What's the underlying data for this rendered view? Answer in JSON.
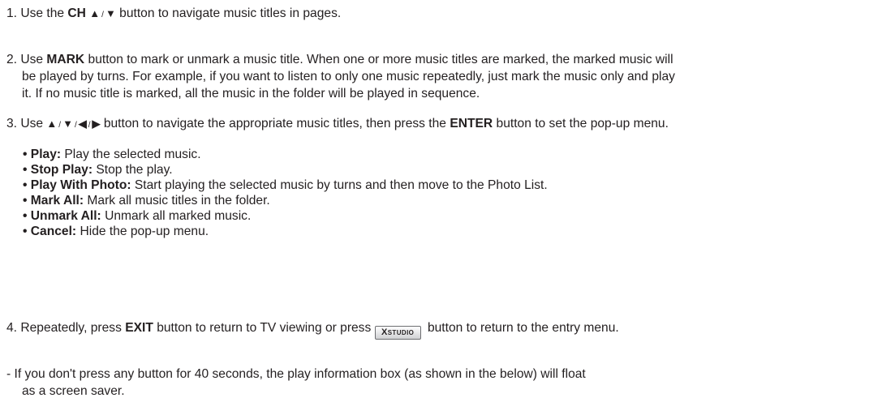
{
  "step1": {
    "prefix": "1. Use the ",
    "key": "CH ",
    "up": "▲",
    "sep": "/",
    "down": "▼",
    "suffix": " button to navigate music titles in pages."
  },
  "step2": {
    "prefix": "2. Use ",
    "key": "MARK",
    "line1_suffix": " button to mark or unmark a music title. When one or more music titles are marked, the marked music will",
    "line2": "be played by turns. For example, if you want to listen to only one music repeatedly, just mark the music only and play",
    "line3": "it. If no music title is marked, all the music in the folder  will be played in sequence."
  },
  "step3": {
    "prefix": "3. Use ",
    "up": "▲",
    "down": "▼",
    "left": "◀",
    "right": "▶",
    "sep": "/",
    "middle": " button to navigate the appropriate music titles, then press the ",
    "key": "ENTER",
    "suffix": " button to set the pop-up  menu."
  },
  "menu_items": [
    {
      "bullet": "• ",
      "term": "Play:",
      "desc": " Play the selected music."
    },
    {
      "bullet": "• ",
      "term": "Stop Play:",
      "desc": " Stop the play."
    },
    {
      "bullet": "• ",
      "term": "Play With Photo:",
      "desc": " Start playing the selected music by turns and then move to the Photo List."
    },
    {
      "bullet": "• ",
      "term": "Mark All:",
      "desc": " Mark all music titles in the folder."
    },
    {
      "bullet": "• ",
      "term": "Unmark All:",
      "desc": " Unmark all marked music."
    },
    {
      "bullet": "• ",
      "term": "Cancel:",
      "desc": " Hide the pop-up menu."
    }
  ],
  "step4": {
    "prefix": "4. Repeatedly, press ",
    "key": "EXIT",
    "middle": " button to return to TV viewing or press ",
    "button_x": "X",
    "button_label": "STUDIO",
    "suffix": " button to return to the entry menu."
  },
  "note": {
    "line1": "- If you don't press any button for 40 seconds, the play information box (as shown in the below) will float",
    "line2": "as a screen saver."
  }
}
